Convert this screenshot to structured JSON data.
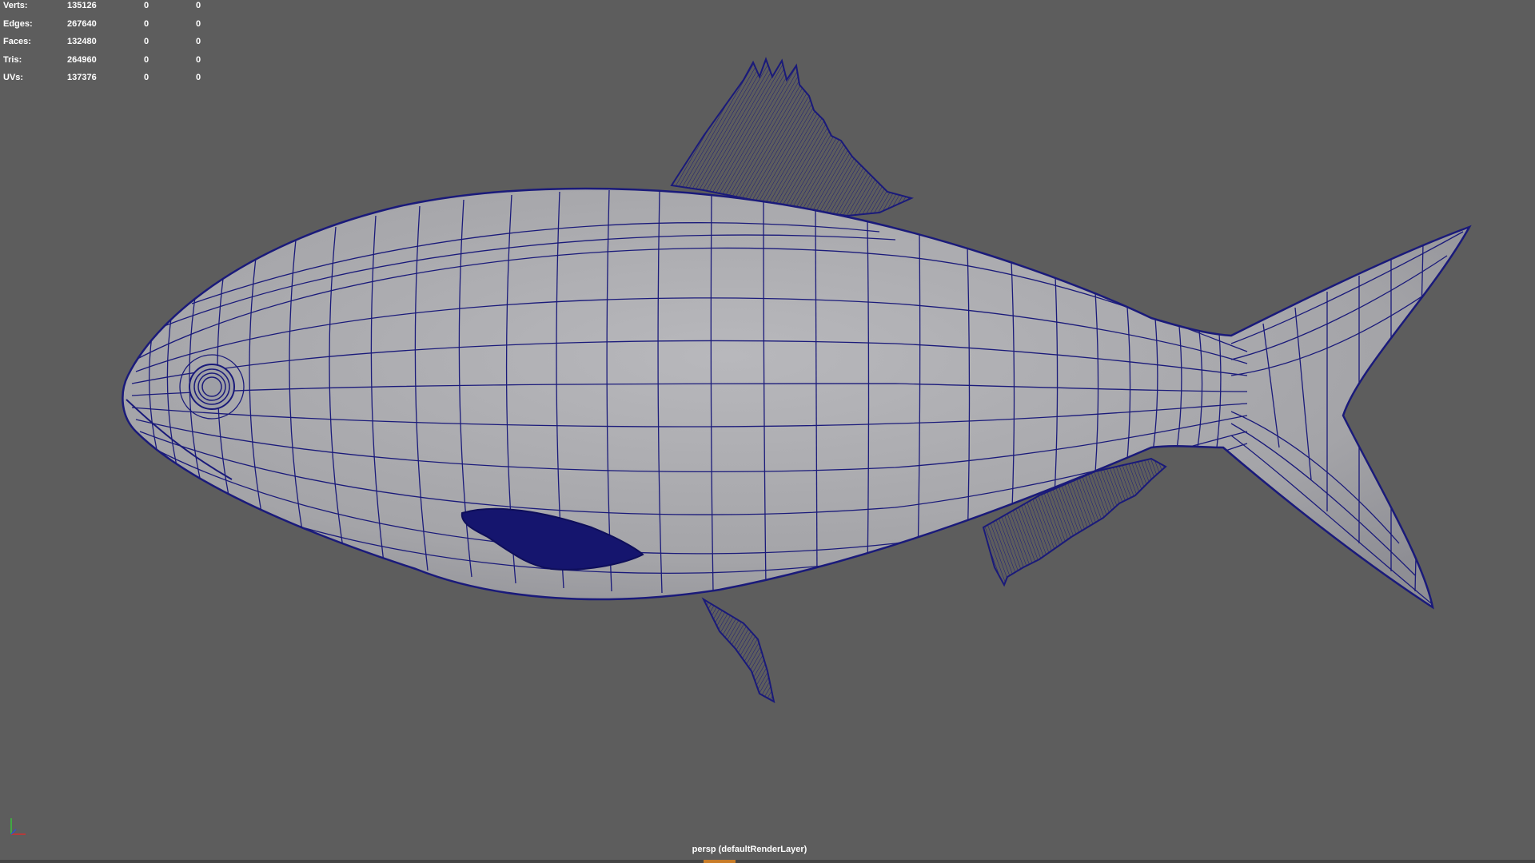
{
  "hud": {
    "rows": [
      {
        "label": "Verts:",
        "total": "135126",
        "selected": "0",
        "component": "0"
      },
      {
        "label": "Edges:",
        "total": "267640",
        "selected": "0",
        "component": "0"
      },
      {
        "label": "Faces:",
        "total": "132480",
        "selected": "0",
        "component": "0"
      },
      {
        "label": "Tris:",
        "total": "264960",
        "selected": "0",
        "component": "0"
      },
      {
        "label": "UVs:",
        "total": "137376",
        "selected": "0",
        "component": "0"
      }
    ]
  },
  "viewport": {
    "camera_label": "persp (defaultRenderLayer)",
    "background_color": "#5d5d5d",
    "wire_color": "#1a1a7a",
    "mesh_color": "#a9a9ad"
  },
  "axis_indicator": {
    "icon": "xyz-axis-icon"
  }
}
